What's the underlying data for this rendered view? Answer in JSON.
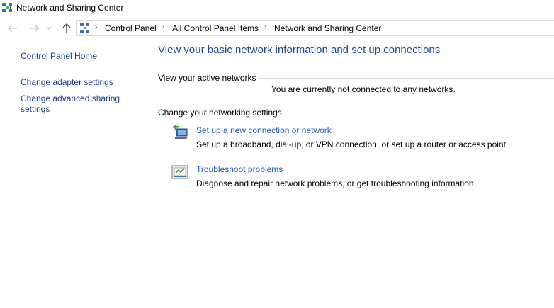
{
  "window": {
    "title": "Network and Sharing Center"
  },
  "nav": {
    "back_icon": "arrow-left-icon",
    "forward_icon": "arrow-right-icon",
    "recent_icon": "chevron-down-icon",
    "up_icon": "arrow-up-icon"
  },
  "breadcrumb": {
    "items": [
      "Control Panel",
      "All Control Panel Items",
      "Network and Sharing Center"
    ]
  },
  "sidebar": {
    "items": [
      {
        "label": "Control Panel Home"
      },
      {
        "label": "Change adapter settings"
      },
      {
        "label": "Change advanced sharing settings"
      }
    ]
  },
  "main": {
    "title": "View your basic network information and set up connections",
    "active_networks": {
      "heading": "View your active networks",
      "status": "You are currently not connected to any networks."
    },
    "networking_settings": {
      "heading": "Change your networking settings",
      "tasks": [
        {
          "icon": "new-connection-icon",
          "link": "Set up a new connection or network",
          "description": "Set up a broadband, dial-up, or VPN connection; or set up a router or access point."
        },
        {
          "icon": "troubleshoot-icon",
          "link": "Troubleshoot problems",
          "description": "Diagnose and repair network problems, or get troubleshooting information."
        }
      ]
    }
  },
  "colors": {
    "link": "#1a5fb4",
    "title": "#1e4a9c",
    "nav_link": "#1a3e8c"
  }
}
